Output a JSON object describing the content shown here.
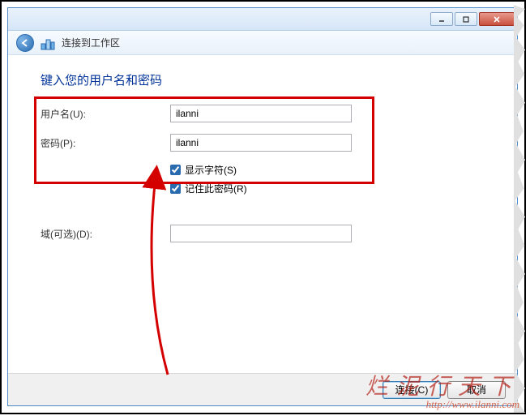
{
  "window": {
    "nav_title": "连接到工作区"
  },
  "heading": "键入您的用户名和密码",
  "fields": {
    "username_label": "用户名(U):",
    "username_value": "ilanni",
    "password_label": "密码(P):",
    "password_value": "ilanni",
    "domain_label": "域(可选)(D):",
    "domain_value": ""
  },
  "checkboxes": {
    "show_chars": "显示字符(S)",
    "remember": "记住此密码(R)"
  },
  "buttons": {
    "connect": "连接(C)",
    "cancel": "取消"
  },
  "watermark": {
    "line1": "烂泥行天下",
    "line2": "http://www.ilanni.com"
  }
}
